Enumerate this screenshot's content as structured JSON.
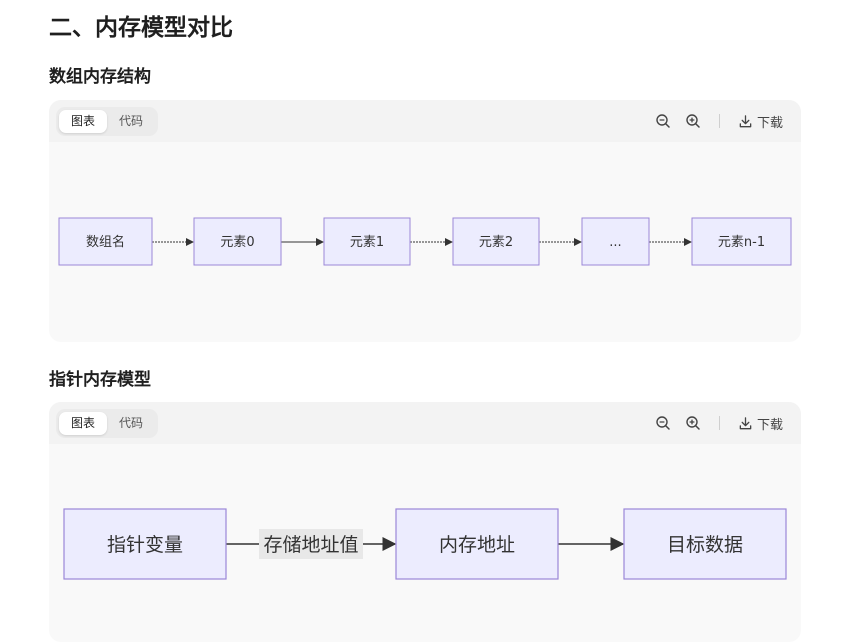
{
  "section_title": "二、内存模型对比",
  "array": {
    "title": "数组内存结构",
    "tabs": [
      "图表",
      "代码"
    ],
    "download_label": "下载",
    "nodes": [
      "数组名",
      "元素0",
      "元素1",
      "元素2",
      "...",
      "元素n-1"
    ]
  },
  "pointer": {
    "title": "指针内存模型",
    "tabs": [
      "图表",
      "代码"
    ],
    "download_label": "下载",
    "nodes": [
      "指针变量",
      "内存地址",
      "目标数据"
    ],
    "edge_label": "存储地址值"
  },
  "colors": {
    "node_fill": "#ececfe",
    "node_stroke": "#9b87d8",
    "edge": "#333333",
    "edge_label_bg": "#e8e8e8"
  }
}
